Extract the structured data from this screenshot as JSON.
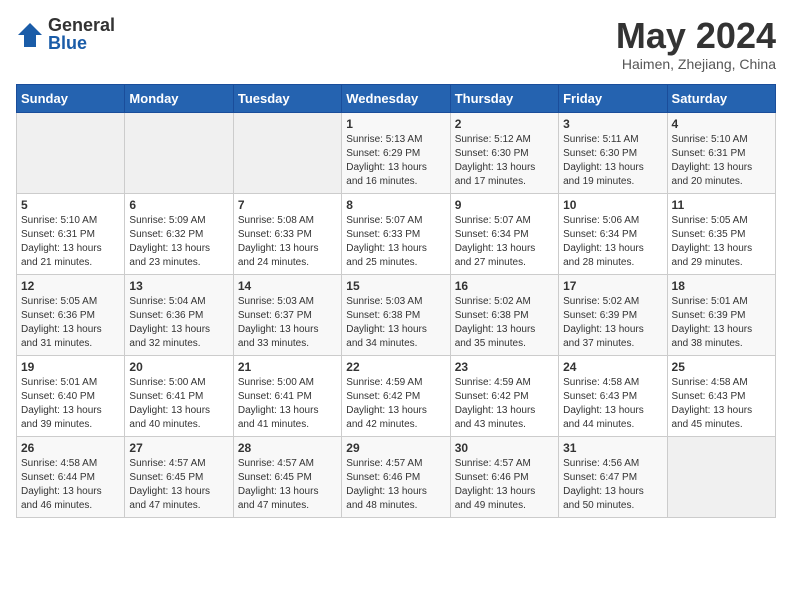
{
  "logo": {
    "general": "General",
    "blue": "Blue"
  },
  "title": "May 2024",
  "location": "Haimen, Zhejiang, China",
  "headers": [
    "Sunday",
    "Monday",
    "Tuesday",
    "Wednesday",
    "Thursday",
    "Friday",
    "Saturday"
  ],
  "weeks": [
    [
      {
        "day": "",
        "info": ""
      },
      {
        "day": "",
        "info": ""
      },
      {
        "day": "",
        "info": ""
      },
      {
        "day": "1",
        "info": "Sunrise: 5:13 AM\nSunset: 6:29 PM\nDaylight: 13 hours\nand 16 minutes."
      },
      {
        "day": "2",
        "info": "Sunrise: 5:12 AM\nSunset: 6:30 PM\nDaylight: 13 hours\nand 17 minutes."
      },
      {
        "day": "3",
        "info": "Sunrise: 5:11 AM\nSunset: 6:30 PM\nDaylight: 13 hours\nand 19 minutes."
      },
      {
        "day": "4",
        "info": "Sunrise: 5:10 AM\nSunset: 6:31 PM\nDaylight: 13 hours\nand 20 minutes."
      }
    ],
    [
      {
        "day": "5",
        "info": "Sunrise: 5:10 AM\nSunset: 6:31 PM\nDaylight: 13 hours\nand 21 minutes."
      },
      {
        "day": "6",
        "info": "Sunrise: 5:09 AM\nSunset: 6:32 PM\nDaylight: 13 hours\nand 23 minutes."
      },
      {
        "day": "7",
        "info": "Sunrise: 5:08 AM\nSunset: 6:33 PM\nDaylight: 13 hours\nand 24 minutes."
      },
      {
        "day": "8",
        "info": "Sunrise: 5:07 AM\nSunset: 6:33 PM\nDaylight: 13 hours\nand 25 minutes."
      },
      {
        "day": "9",
        "info": "Sunrise: 5:07 AM\nSunset: 6:34 PM\nDaylight: 13 hours\nand 27 minutes."
      },
      {
        "day": "10",
        "info": "Sunrise: 5:06 AM\nSunset: 6:34 PM\nDaylight: 13 hours\nand 28 minutes."
      },
      {
        "day": "11",
        "info": "Sunrise: 5:05 AM\nSunset: 6:35 PM\nDaylight: 13 hours\nand 29 minutes."
      }
    ],
    [
      {
        "day": "12",
        "info": "Sunrise: 5:05 AM\nSunset: 6:36 PM\nDaylight: 13 hours\nand 31 minutes."
      },
      {
        "day": "13",
        "info": "Sunrise: 5:04 AM\nSunset: 6:36 PM\nDaylight: 13 hours\nand 32 minutes."
      },
      {
        "day": "14",
        "info": "Sunrise: 5:03 AM\nSunset: 6:37 PM\nDaylight: 13 hours\nand 33 minutes."
      },
      {
        "day": "15",
        "info": "Sunrise: 5:03 AM\nSunset: 6:38 PM\nDaylight: 13 hours\nand 34 minutes."
      },
      {
        "day": "16",
        "info": "Sunrise: 5:02 AM\nSunset: 6:38 PM\nDaylight: 13 hours\nand 35 minutes."
      },
      {
        "day": "17",
        "info": "Sunrise: 5:02 AM\nSunset: 6:39 PM\nDaylight: 13 hours\nand 37 minutes."
      },
      {
        "day": "18",
        "info": "Sunrise: 5:01 AM\nSunset: 6:39 PM\nDaylight: 13 hours\nand 38 minutes."
      }
    ],
    [
      {
        "day": "19",
        "info": "Sunrise: 5:01 AM\nSunset: 6:40 PM\nDaylight: 13 hours\nand 39 minutes."
      },
      {
        "day": "20",
        "info": "Sunrise: 5:00 AM\nSunset: 6:41 PM\nDaylight: 13 hours\nand 40 minutes."
      },
      {
        "day": "21",
        "info": "Sunrise: 5:00 AM\nSunset: 6:41 PM\nDaylight: 13 hours\nand 41 minutes."
      },
      {
        "day": "22",
        "info": "Sunrise: 4:59 AM\nSunset: 6:42 PM\nDaylight: 13 hours\nand 42 minutes."
      },
      {
        "day": "23",
        "info": "Sunrise: 4:59 AM\nSunset: 6:42 PM\nDaylight: 13 hours\nand 43 minutes."
      },
      {
        "day": "24",
        "info": "Sunrise: 4:58 AM\nSunset: 6:43 PM\nDaylight: 13 hours\nand 44 minutes."
      },
      {
        "day": "25",
        "info": "Sunrise: 4:58 AM\nSunset: 6:43 PM\nDaylight: 13 hours\nand 45 minutes."
      }
    ],
    [
      {
        "day": "26",
        "info": "Sunrise: 4:58 AM\nSunset: 6:44 PM\nDaylight: 13 hours\nand 46 minutes."
      },
      {
        "day": "27",
        "info": "Sunrise: 4:57 AM\nSunset: 6:45 PM\nDaylight: 13 hours\nand 47 minutes."
      },
      {
        "day": "28",
        "info": "Sunrise: 4:57 AM\nSunset: 6:45 PM\nDaylight: 13 hours\nand 47 minutes."
      },
      {
        "day": "29",
        "info": "Sunrise: 4:57 AM\nSunset: 6:46 PM\nDaylight: 13 hours\nand 48 minutes."
      },
      {
        "day": "30",
        "info": "Sunrise: 4:57 AM\nSunset: 6:46 PM\nDaylight: 13 hours\nand 49 minutes."
      },
      {
        "day": "31",
        "info": "Sunrise: 4:56 AM\nSunset: 6:47 PM\nDaylight: 13 hours\nand 50 minutes."
      },
      {
        "day": "",
        "info": ""
      }
    ]
  ]
}
